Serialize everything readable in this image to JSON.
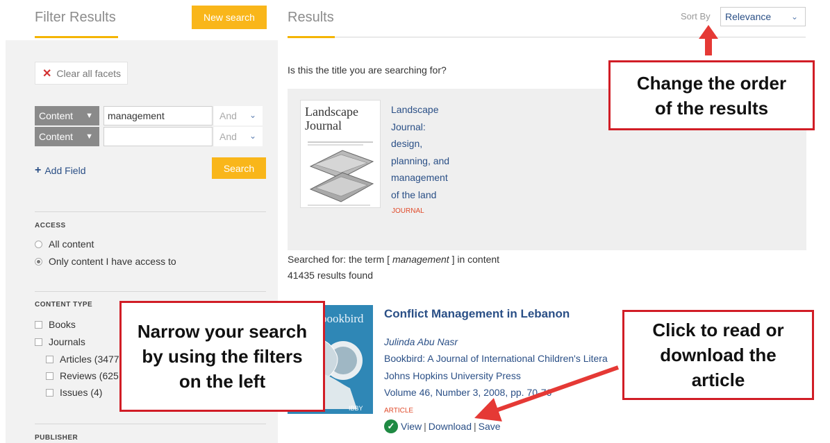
{
  "filter": {
    "title": "Filter Results",
    "new_search_label": "New search",
    "clear_facets_label": "Clear all facets",
    "fields": [
      {
        "type_label": "Content",
        "value": "management",
        "operator": "And"
      },
      {
        "type_label": "Content",
        "value": "",
        "operator": "And"
      }
    ],
    "add_field_label": "Add Field",
    "search_label": "Search",
    "access": {
      "heading": "ACCESS",
      "options": [
        {
          "label": "All content",
          "checked": false
        },
        {
          "label": "Only content I have access to",
          "checked": true
        }
      ]
    },
    "content_type": {
      "heading": "CONTENT TYPE",
      "options": [
        {
          "label": "Books"
        },
        {
          "label": "Journals"
        },
        {
          "label": "Articles (3477"
        },
        {
          "label": "Reviews (625"
        },
        {
          "label": "Issues (4)"
        }
      ]
    },
    "publisher_heading": "PUBLISHER"
  },
  "results": {
    "title": "Results",
    "sort_label": "Sort By",
    "sort_value": "Relevance",
    "suggest_question": "Is this the title you are searching for?",
    "suggested_journal": {
      "cover_title": "Landscape Journal",
      "lines": [
        "Landscape",
        "Journal:",
        "design,",
        "planning, and",
        "management",
        "of the land"
      ],
      "type": "JOURNAL"
    },
    "searched_prefix": "Searched for: the term [",
    "searched_term": "management",
    "searched_suffix": "] in content",
    "count_text": "41435 results found",
    "article": {
      "cover_label": "bookbird",
      "title": "Conflict Management in Lebanon",
      "author": "Julinda Abu Nasr",
      "journal": "Bookbird: A Journal of International Children's Litera",
      "publisher": "Johns Hopkins University Press",
      "volume": "Volume 46, Number 3, 2008, pp. 70-76",
      "type": "ARTICLE",
      "actions": {
        "view": "View",
        "download": "Download",
        "save": "Save",
        "separator": "|"
      }
    }
  },
  "annotations": {
    "order": [
      "Change the order",
      "of the results"
    ],
    "narrow": [
      "Narrow your search",
      "by using the filters",
      "on the left"
    ],
    "read": [
      "Click to read or",
      "download the",
      "article"
    ]
  },
  "colors": {
    "accent": "#f9b61a",
    "link": "#2a4f86",
    "callout_border": "#d11d26",
    "type_label": "#e04b2b",
    "check": "#1f8a43"
  },
  "icons": [
    "close-icon",
    "caret-down-icon",
    "chevron-down-icon",
    "plus-icon",
    "check-circle-icon",
    "arrow-icon"
  ]
}
